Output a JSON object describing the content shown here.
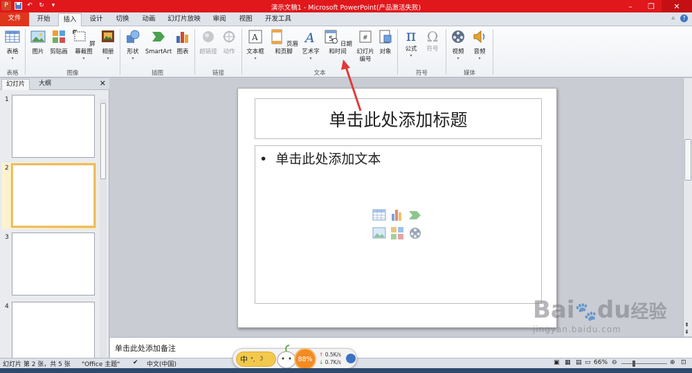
{
  "window": {
    "title": "演示文稿1 - Microsoft PowerPoint(产品激活失败)"
  },
  "tabs": [
    "文件",
    "开始",
    "插入",
    "设计",
    "切换",
    "动画",
    "幻灯片放映",
    "审阅",
    "视图",
    "开发工具"
  ],
  "active_tab": "插入",
  "ribbon": {
    "groups": {
      "table": "表格",
      "image": "图像",
      "illustration": "插图",
      "link": "链接",
      "text": "文本",
      "symbol": "符号",
      "media": "媒体"
    },
    "buttons": {
      "table": "表格",
      "picture": "图片",
      "clipart": "剪贴画",
      "screenshot": "屏幕截图",
      "album": "相册",
      "shapes": "形状",
      "smartart": "SmartArt",
      "chart": "图表",
      "hyperlink": "超链接",
      "action": "动作",
      "textbox": "文本框",
      "header_footer": "页眉和页脚",
      "wordart": "艺术字",
      "datetime": "日期和时间",
      "slide_number_1": "幻灯片",
      "slide_number_2": "编号",
      "object": "对象",
      "equation": "公式",
      "symbol": "符号",
      "video": "视频",
      "audio": "音频"
    },
    "equation_glyph": "π",
    "symbol_glyph": "Ω",
    "datetime_glyph": "5"
  },
  "panel": {
    "tabs": [
      "幻灯片",
      "大纲"
    ],
    "slide_numbers": [
      "1",
      "2",
      "3",
      "4"
    ],
    "selected": "2"
  },
  "slide": {
    "title_placeholder": "单击此处添加标题",
    "body_placeholder": "单击此处添加文本",
    "bullet": "•"
  },
  "notes": {
    "placeholder": "单击此处添加备注"
  },
  "status": {
    "slide_info": "幻灯片 第 2 张，共 5 张",
    "theme": "\"Office 主题\"",
    "language": "中文(中国)",
    "zoom": "66%"
  },
  "floating": {
    "ime": "中",
    "cpu": "88%",
    "up": "0.5K/s",
    "down": "0.7K/s"
  },
  "watermark": {
    "brand": "Bai",
    "brand2": "du",
    "cn": "经验",
    "url": "jingyan.baidu.com"
  },
  "colors": {
    "titlebar": "#e0171b",
    "file_tab": "#e0351d",
    "accent_arrow": "#e03a3a"
  }
}
